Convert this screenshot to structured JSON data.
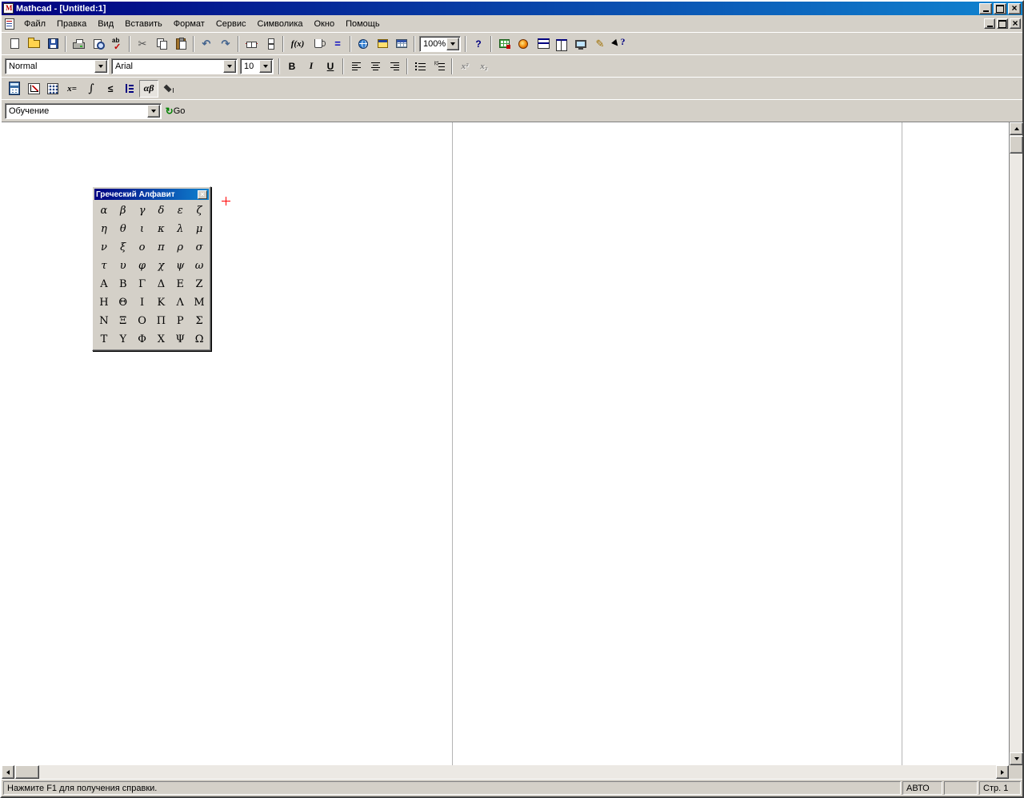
{
  "window": {
    "title": "Mathcad - [Untitled:1]",
    "controls": [
      "minimize-icon",
      "restore-icon",
      "close-icon"
    ]
  },
  "menu": {
    "items": [
      "Файл",
      "Правка",
      "Вид",
      "Вставить",
      "Формат",
      "Сервис",
      "Символика",
      "Окно",
      "Помощь"
    ],
    "mdi_controls": [
      "minimize-icon",
      "restore-icon",
      "close-icon"
    ]
  },
  "standard_toolbar": {
    "buttons": [
      "new",
      "open",
      "save",
      "print",
      "print-preview",
      "check-spelling",
      "cut",
      "copy",
      "paste",
      "undo",
      "redo",
      "align-across",
      "align-down",
      "insert-function",
      "insert-unit",
      "calculate",
      "insert-hyperlink",
      "insert-component",
      "insert-table",
      "zoom",
      "help",
      "mathsoft-sheet",
      "resource-center",
      "tile-horizontal",
      "tile-vertical",
      "collaboratory",
      "annotate",
      "context-help"
    ],
    "insert_function_label": "f(x)",
    "calculate_label": "=",
    "zoom_value": "100%",
    "help_label": "?"
  },
  "formatting_toolbar": {
    "style_value": "Normal",
    "font_value": "Arial",
    "size_value": "10",
    "bold_label": "B",
    "italic_label": "I",
    "underline_label": "U",
    "superscript_label": "x²",
    "subscript_label": "x₂"
  },
  "math_toolbar": {
    "buttons": [
      "calculator-palette",
      "graph-palette",
      "matrix-palette",
      "evaluation-palette",
      "calculus-palette",
      "boolean-palette",
      "programming-palette",
      "greek-palette",
      "symbolic-palette"
    ],
    "evaluation_label": "x=",
    "calculus_label": "∫",
    "boolean_label": "≤",
    "greek_label": "αβ",
    "greek_pressed": true
  },
  "resources_toolbar": {
    "resource_value": "Обучение",
    "go_label": "Go",
    "go_icon": "go-icon"
  },
  "greek_palette": {
    "title": "Греческий Алфавит",
    "close_icon": "close-icon",
    "letters": [
      [
        "α",
        "β",
        "γ",
        "δ",
        "ε",
        "ζ"
      ],
      [
        "η",
        "θ",
        "ι",
        "κ",
        "λ",
        "μ"
      ],
      [
        "ν",
        "ξ",
        "ο",
        "π",
        "ρ",
        "σ"
      ],
      [
        "τ",
        "υ",
        "φ",
        "χ",
        "ψ",
        "ω"
      ],
      [
        "Α",
        "Β",
        "Γ",
        "Δ",
        "Ε",
        "Ζ"
      ],
      [
        "Η",
        "Θ",
        "Ι",
        "Κ",
        "Λ",
        "Μ"
      ],
      [
        "Ν",
        "Ξ",
        "Ο",
        "Π",
        "Ρ",
        "Σ"
      ],
      [
        "Τ",
        "Υ",
        "Φ",
        "Χ",
        "Ψ",
        "Ω"
      ]
    ]
  },
  "status_bar": {
    "help_text": "Нажмите F1 для получения справки.",
    "auto_label": "АВТО",
    "page_label": "Стр. 1"
  },
  "colors": {
    "titlebar_start": "#000080",
    "titlebar_end": "#1084d0",
    "chrome": "#d4d0c8",
    "crosshair": "#ff0000"
  }
}
